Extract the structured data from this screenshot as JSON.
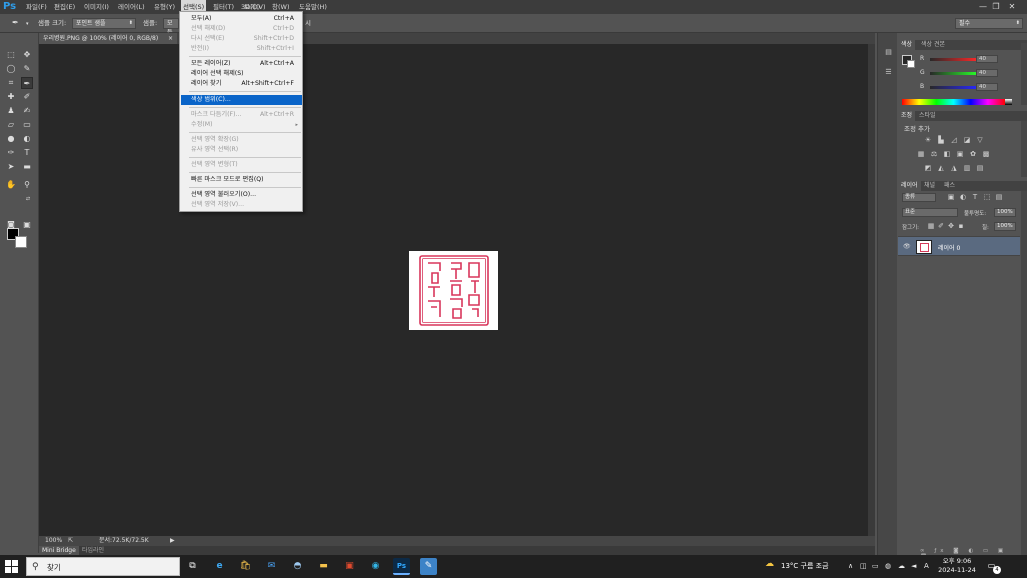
{
  "menubar": {
    "logo": "Ps",
    "items": [
      "파일(F)",
      "편집(E)",
      "이미지(I)",
      "레이어(L)",
      "유형(Y)",
      "선택(S)",
      "필터(T)",
      "3D(D)",
      "보기(V)",
      "창(W)",
      "도움말(H)"
    ],
    "window_min": "—",
    "window_max": "❐",
    "window_close": "✕"
  },
  "options": {
    "sample_size_label": "샘플 크기:",
    "sample_size_value": "포인트 샘플",
    "sample_label": "샘플:",
    "sample_value": "모든",
    "hidden_tail": "시",
    "workspace_value": "필수"
  },
  "document": {
    "tab_title": "우리병원.PNG @ 100% (레이어 0, RGB/8)",
    "tab_close": "×",
    "zoom": "100%",
    "doc_size": "문서:72.5K/72.5K",
    "play": "▶"
  },
  "minibridge": {
    "tab1": "Mini Bridge",
    "tab2": "타임라인"
  },
  "select_menu": {
    "items": [
      {
        "label": "모두(A)",
        "shortcut": "Ctrl+A",
        "disabled": false
      },
      {
        "label": "선택 해제(D)",
        "shortcut": "Ctrl+D",
        "disabled": true
      },
      {
        "label": "다시 선택(E)",
        "shortcut": "Shift+Ctrl+D",
        "disabled": true
      },
      {
        "label": "반전(I)",
        "shortcut": "Shift+Ctrl+I",
        "disabled": true
      },
      {
        "label": "모든 레이어(Z)",
        "shortcut": "Alt+Ctrl+A",
        "disabled": false
      },
      {
        "label": "레이어 선택 해제(S)",
        "shortcut": "",
        "disabled": false
      },
      {
        "label": "레이어 찾기",
        "shortcut": "Alt+Shift+Ctrl+F",
        "disabled": false
      },
      {
        "label": "색상 범위(C)...",
        "shortcut": "",
        "disabled": false
      },
      {
        "label": "마스크 다듬기(F)...",
        "shortcut": "Alt+Ctrl+R",
        "disabled": true
      },
      {
        "label": "수정(M)",
        "shortcut": "",
        "disabled": true
      },
      {
        "label": "선택 영역 확장(G)",
        "shortcut": "",
        "disabled": true
      },
      {
        "label": "유사 영역 선택(R)",
        "shortcut": "",
        "disabled": true
      },
      {
        "label": "선택 영역 변형(T)",
        "shortcut": "",
        "disabled": true
      },
      {
        "label": "빠른 마스크 모드로 편집(Q)",
        "shortcut": "",
        "disabled": false
      },
      {
        "label": "선택 영역 불러오기(O)...",
        "shortcut": "",
        "disabled": false
      },
      {
        "label": "선택 영역 저장(V)...",
        "shortcut": "",
        "disabled": true
      }
    ],
    "submenu_arrow": "▸"
  },
  "color_panel": {
    "tab1": "색상",
    "tab2": "색상 견본",
    "r_label": "R",
    "g_label": "G",
    "b_label": "B",
    "r_value": "40",
    "g_value": "40",
    "b_value": "40"
  },
  "adjust_panel": {
    "tab1": "조정",
    "tab2": "스타일",
    "title": "조정 추가"
  },
  "layers_panel": {
    "tab1": "레이어",
    "tab2": "채널",
    "tab3": "패스",
    "kind_value": "종류",
    "blend_value": "표준",
    "opacity_label": "불투명도:",
    "opacity_value": "100%",
    "lock_label": "잠그기:",
    "fill_label": "칠:",
    "fill_value": "100%",
    "layer_name": "레이어 0"
  },
  "taskbar": {
    "search_placeholder": "찾기",
    "weather": "13°C 구름 조금",
    "time": "오후 9:06",
    "date": "2024-11-24",
    "notif_count": "4"
  }
}
